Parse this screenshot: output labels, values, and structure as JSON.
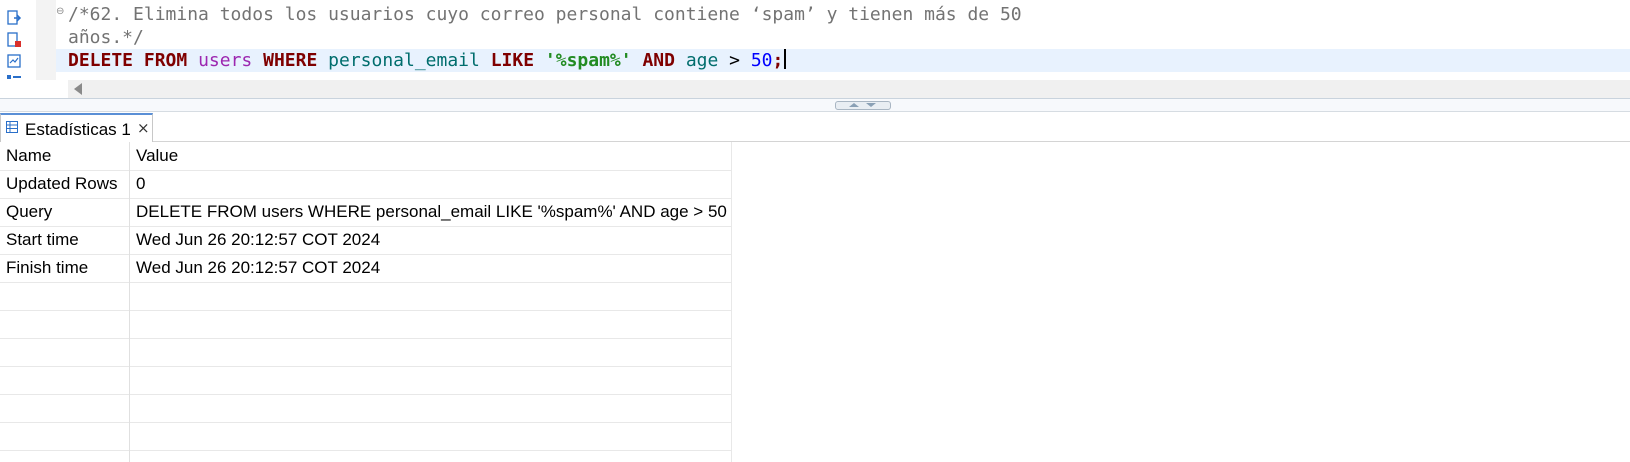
{
  "editor": {
    "lines": [
      [
        {
          "t": "/*62. Elimina todos los usuarios cuyo correo personal contiene ‘spam’ y tienen más de 50",
          "c": "c-comment"
        }
      ],
      [
        {
          "t": "años.*/",
          "c": "c-comment"
        }
      ],
      [
        {
          "t": "DELETE",
          "c": "c-kw"
        },
        {
          "t": " ",
          "c": "c-op"
        },
        {
          "t": "FROM",
          "c": "c-kw"
        },
        {
          "t": " ",
          "c": "c-op"
        },
        {
          "t": "users",
          "c": "c-tbl"
        },
        {
          "t": " ",
          "c": "c-op"
        },
        {
          "t": "WHERE",
          "c": "c-kw"
        },
        {
          "t": " ",
          "c": "c-op"
        },
        {
          "t": "personal_email",
          "c": "c-col"
        },
        {
          "t": " ",
          "c": "c-op"
        },
        {
          "t": "LIKE",
          "c": "c-kw"
        },
        {
          "t": " ",
          "c": "c-op"
        },
        {
          "t": "'%spam%'",
          "c": "c-str"
        },
        {
          "t": " ",
          "c": "c-op"
        },
        {
          "t": "AND",
          "c": "c-kw"
        },
        {
          "t": " ",
          "c": "c-op"
        },
        {
          "t": "age",
          "c": "c-col"
        },
        {
          "t": " > ",
          "c": "c-op"
        },
        {
          "t": "50",
          "c": "c-num"
        },
        {
          "t": ";",
          "c": "c-kw"
        }
      ]
    ]
  },
  "results": {
    "tab_label": "Estadísticas 1",
    "tab_close": "×",
    "rows": [
      {
        "name": "Name",
        "value": "Value"
      },
      {
        "name": "Updated Rows",
        "value": "0"
      },
      {
        "name": "Query",
        "value": "DELETE FROM users WHERE personal_email LIKE '%spam%' AND age > 50"
      },
      {
        "name": "Start time",
        "value": "Wed Jun 26 20:12:57 COT 2024"
      },
      {
        "name": "Finish time",
        "value": "Wed Jun 26 20:12:57 COT 2024"
      },
      {
        "name": "",
        "value": ""
      },
      {
        "name": "",
        "value": ""
      },
      {
        "name": "",
        "value": ""
      },
      {
        "name": "",
        "value": ""
      },
      {
        "name": "",
        "value": ""
      },
      {
        "name": "",
        "value": ""
      }
    ]
  },
  "icons": {
    "toolbar": [
      "execute-script-icon",
      "execute-file-icon",
      "explain-plan-icon",
      "outline-icon"
    ],
    "tab": "table-grid-icon",
    "accent": "#5a8fd6"
  }
}
